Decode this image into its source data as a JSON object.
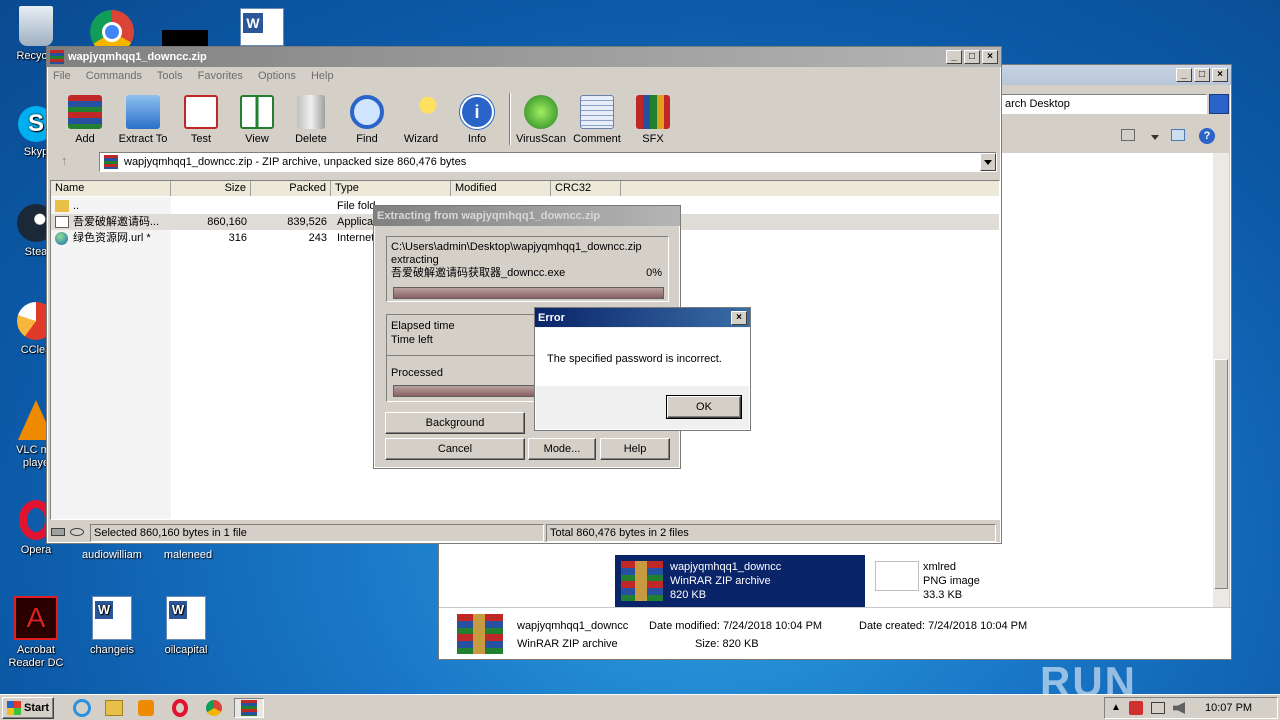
{
  "desktop": {
    "icons": [
      {
        "label": "Recycle"
      },
      {
        "label": "Skyp"
      },
      {
        "label": "Stea"
      },
      {
        "label": "CClea"
      },
      {
        "label": "VLC me\nplaye"
      },
      {
        "label": "Opera"
      },
      {
        "label": "audiowilliam"
      },
      {
        "label": "maleneed"
      },
      {
        "label": "Acrobat Reader DC"
      },
      {
        "label": "changeis"
      },
      {
        "label": "oilcapital"
      }
    ]
  },
  "explorer": {
    "search_placeholder": "arch Desktop",
    "selected_file": {
      "name": "wapjyqmhqq1_downcc",
      "type": "WinRAR ZIP archive",
      "size": "820 KB"
    },
    "other_file": {
      "name": "xmlred",
      "type": "PNG image",
      "size": "33.3 KB"
    },
    "details": {
      "name": "wapjyqmhqq1_downcc",
      "type": "WinRAR ZIP archive",
      "modified_label": "Date modified:",
      "modified": "7/24/2018 10:04 PM",
      "size_label": "Size:",
      "size": "820 KB",
      "created_label": "Date created:",
      "created": "7/24/2018 10:04 PM"
    }
  },
  "winrar": {
    "title": "wapjyqmhqq1_downcc.zip",
    "menu": [
      "File",
      "Commands",
      "Tools",
      "Favorites",
      "Options",
      "Help"
    ],
    "tools": [
      "Add",
      "Extract To",
      "Test",
      "View",
      "Delete",
      "Find",
      "Wizard",
      "Info",
      "VirusScan",
      "Comment",
      "SFX"
    ],
    "path": "wapjyqmhqq1_downcc.zip - ZIP archive, unpacked size 860,476 bytes",
    "columns": [
      "Name",
      "Size",
      "Packed",
      "Type",
      "Modified",
      "CRC32"
    ],
    "rows": [
      {
        "name": "..",
        "size": "",
        "packed": "",
        "type": "File fold"
      },
      {
        "name": "吾爱破解邀请码...",
        "size": "860,160",
        "packed": "839,526",
        "type": "Applicat"
      },
      {
        "name": "绿色资源网.url *",
        "size": "316",
        "packed": "243",
        "type": "Internet"
      }
    ],
    "status_left": "Selected 860,160 bytes in 1 file",
    "status_right": "Total 860,476 bytes in 2 files"
  },
  "extract": {
    "title": "Extracting from wapjyqmhqq1_downcc.zip",
    "path": "C:\\Users\\admin\\Desktop\\wapjyqmhqq1_downcc.zip",
    "action": "extracting",
    "file": "吾爱破解邀请码获取器_downcc.exe",
    "percent": "0%",
    "elapsed_label": "Elapsed time",
    "left_label": "Time left",
    "processed_label": "Processed",
    "buttons": {
      "background": "Background",
      "cancel": "Cancel",
      "mode": "Mode...",
      "help": "Help"
    }
  },
  "error": {
    "title": "Error",
    "message": "The specified password is incorrect.",
    "ok": "OK"
  },
  "taskbar": {
    "start": "Start",
    "clock": "10:07 PM"
  },
  "watermark": "ANY RUN"
}
